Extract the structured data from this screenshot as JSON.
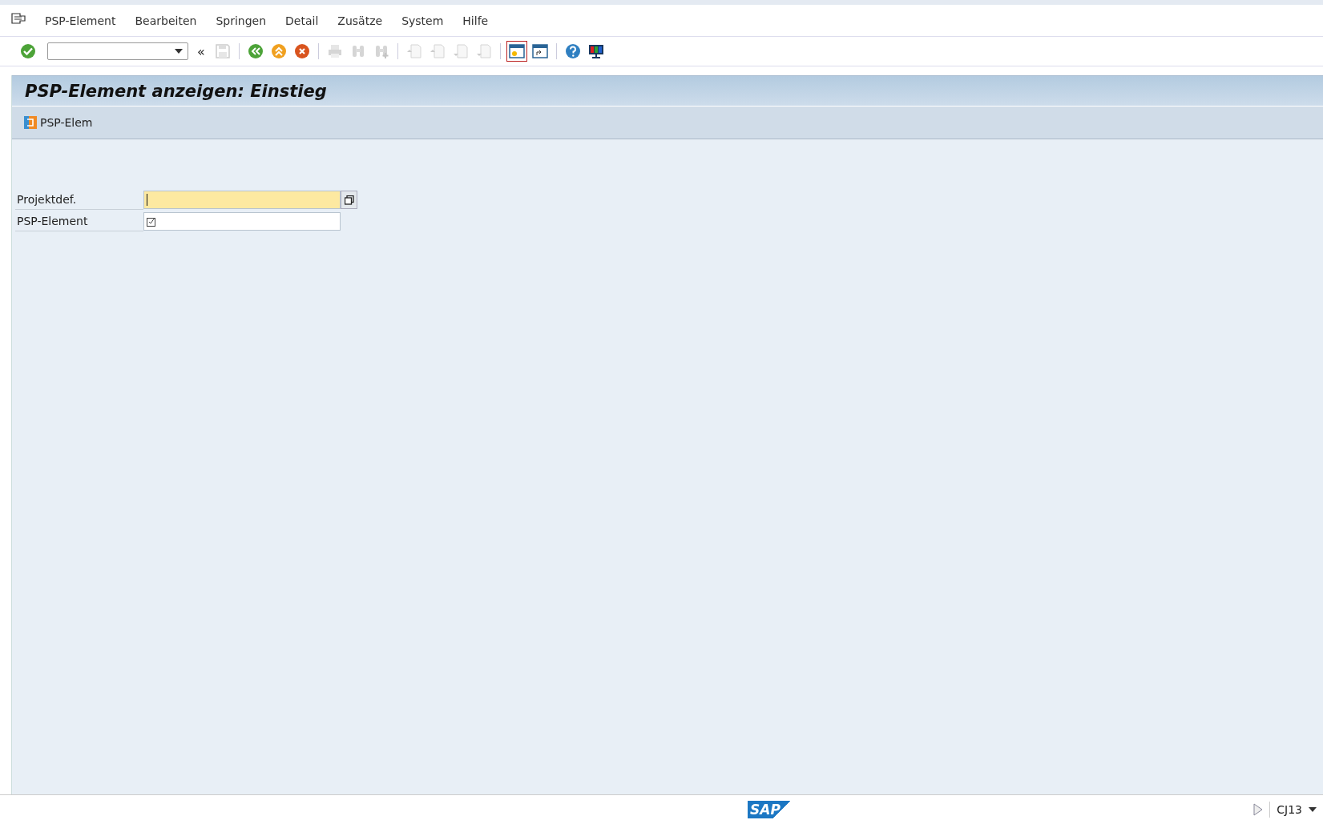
{
  "menu": [
    "PSP-Element",
    "Bearbeiten",
    "Springen",
    "Detail",
    "Zusätze",
    "System",
    "Hilfe"
  ],
  "toolbar": {
    "command_collapse": "«",
    "items": [
      {
        "kind": "enter"
      },
      {
        "kind": "command-field"
      },
      {
        "kind": "collapse"
      },
      {
        "kind": "save",
        "disabled": true
      },
      {
        "kind": "separator"
      },
      {
        "kind": "back"
      },
      {
        "kind": "exit"
      },
      {
        "kind": "cancel"
      },
      {
        "kind": "separator"
      },
      {
        "kind": "print",
        "disabled": true
      },
      {
        "kind": "find",
        "disabled": true
      },
      {
        "kind": "find-next",
        "disabled": true
      },
      {
        "kind": "separator"
      },
      {
        "kind": "first-page",
        "disabled": true
      },
      {
        "kind": "prev-page",
        "disabled": true
      },
      {
        "kind": "next-page",
        "disabled": true
      },
      {
        "kind": "last-page",
        "disabled": true
      },
      {
        "kind": "separator"
      },
      {
        "kind": "new-session",
        "selected": true
      },
      {
        "kind": "shortcut",
        "selected": false
      },
      {
        "kind": "separator"
      },
      {
        "kind": "help"
      },
      {
        "kind": "layout"
      }
    ]
  },
  "title": "PSP-Element anzeigen: Einstieg",
  "app_toolbar": [
    {
      "label": "PSP-Elem"
    }
  ],
  "fields": [
    {
      "label": "Projektdef.",
      "focused": true,
      "required": false,
      "value_help": true
    },
    {
      "label": "PSP-Element",
      "focused": false,
      "required": true
    }
  ],
  "status_bar": {
    "logo": "SAP",
    "transaction": "CJ13"
  }
}
